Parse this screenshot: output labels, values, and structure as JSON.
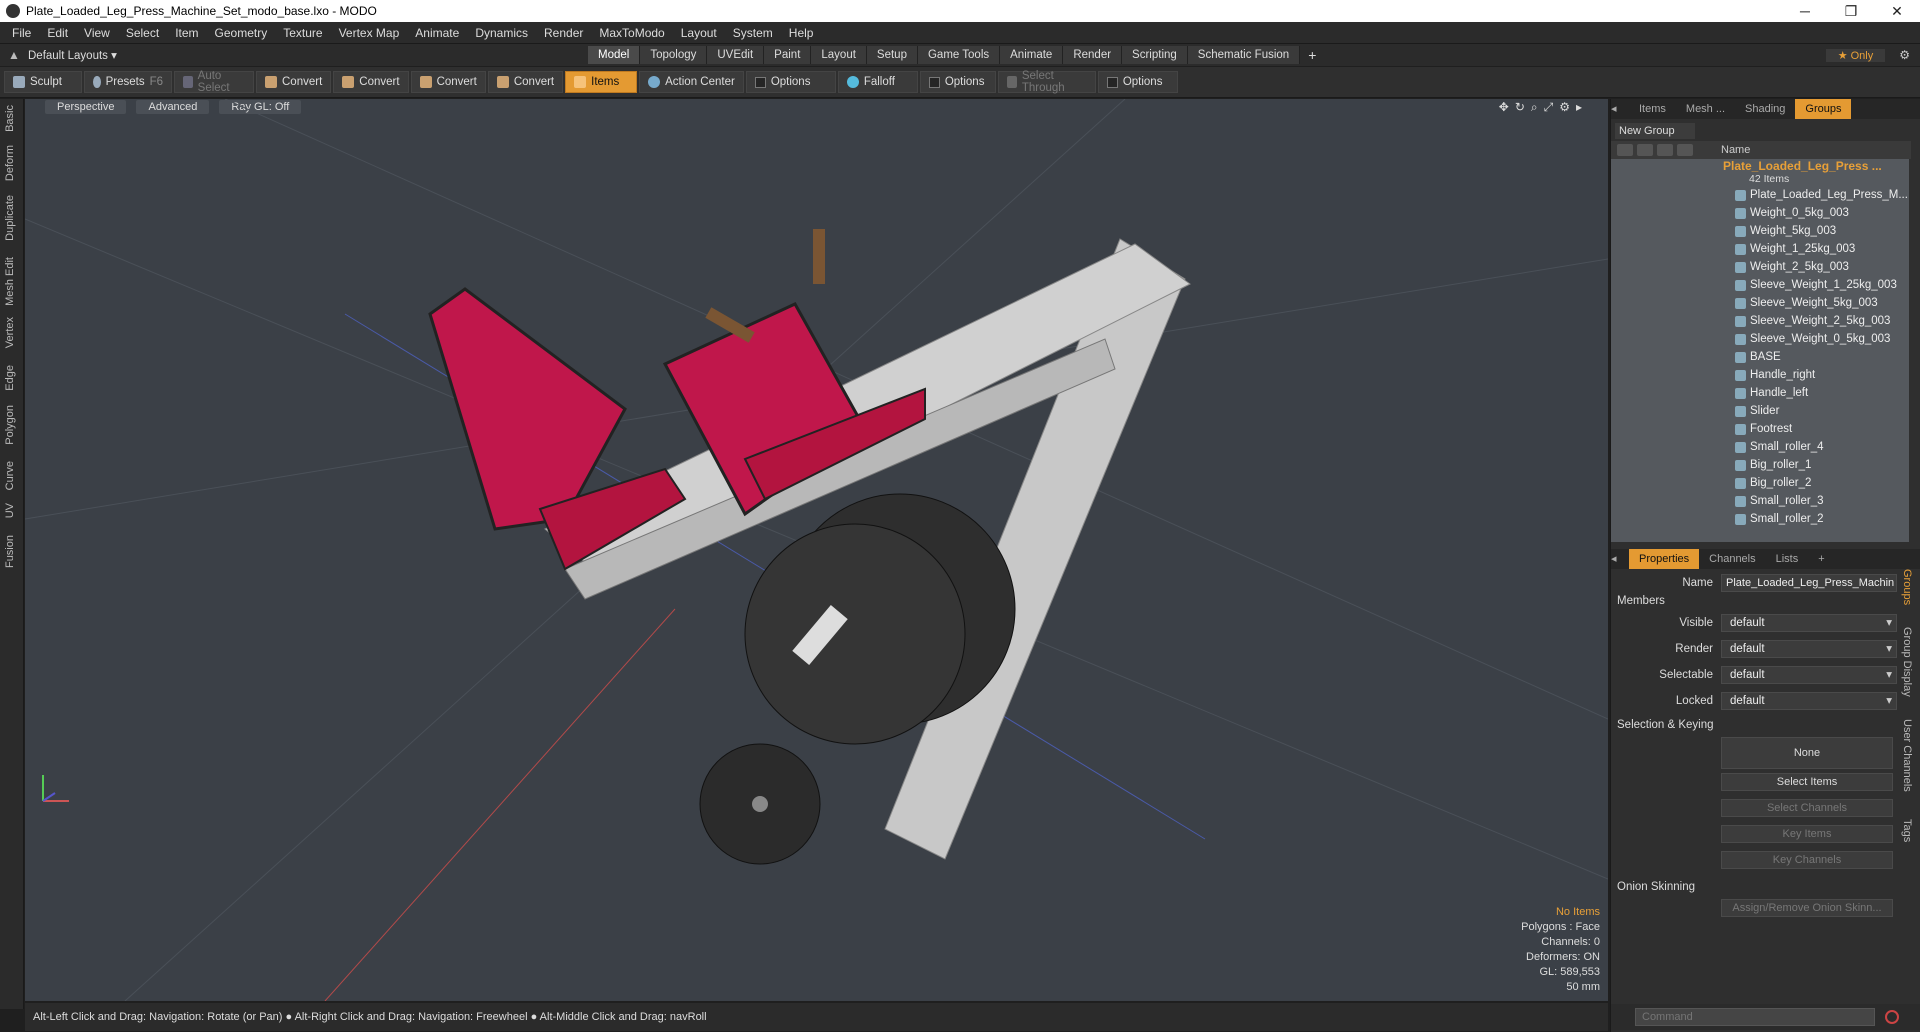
{
  "window": {
    "title": "Plate_Loaded_Leg_Press_Machine_Set_modo_base.lxo - MODO"
  },
  "menu": [
    "File",
    "Edit",
    "View",
    "Select",
    "Item",
    "Geometry",
    "Texture",
    "Vertex Map",
    "Animate",
    "Dynamics",
    "Render",
    "MaxToModo",
    "Layout",
    "System",
    "Help"
  ],
  "layout": {
    "default_label": "Default Layouts ▾",
    "tabs": [
      "Model",
      "Topology",
      "UVEdit",
      "Paint",
      "Layout",
      "Setup",
      "Game Tools",
      "Animate",
      "Render",
      "Scripting",
      "Schematic Fusion"
    ],
    "add": "+",
    "only": "★ Only"
  },
  "toolbar": {
    "sculpt": "Sculpt",
    "presets": "Presets",
    "presets_key": "F6",
    "auto_select": "Auto Select",
    "convert": "Convert",
    "items": "Items",
    "action_center": "Action Center",
    "options": "Options",
    "falloff": "Falloff",
    "select_through": "Select Through"
  },
  "left_tabs": [
    "Basic",
    "Deform",
    "Duplicate",
    "Mesh Edit",
    "Vertex",
    "Edge",
    "Polygon",
    "Curve",
    "UV",
    "Fusion"
  ],
  "viewport": {
    "perspective": "Perspective",
    "advanced": "Advanced",
    "raygl": "Ray GL: Off",
    "stats": {
      "no_items": "No Items",
      "polygons": "Polygons : Face",
      "channels": "Channels: 0",
      "deformers": "Deformers: ON",
      "gl": "GL: 589,553",
      "scale": "50 mm"
    }
  },
  "status": "Alt-Left Click and Drag: Navigation: Rotate (or Pan) ● Alt-Right Click and Drag: Navigation: Freewheel ● Alt-Middle Click and Drag: navRoll",
  "panel_tabs": [
    "Items",
    "Mesh ...",
    "Shading",
    "Groups"
  ],
  "new_group": "New Group",
  "list_header": "Name",
  "group": {
    "name": "Plate_Loaded_Leg_Press ...",
    "count": "42 Items"
  },
  "items": [
    "Plate_Loaded_Leg_Press_M...",
    "Weight_0_5kg_003",
    "Weight_5kg_003",
    "Weight_1_25kg_003",
    "Weight_2_5kg_003",
    "Sleeve_Weight_1_25kg_003",
    "Sleeve_Weight_5kg_003",
    "Sleeve_Weight_2_5kg_003",
    "Sleeve_Weight_0_5kg_003",
    "BASE",
    "Handle_right",
    "Handle_left",
    "Slider",
    "Footrest",
    "Small_roller_4",
    "Big_roller_1",
    "Big_roller_2",
    "Small_roller_3",
    "Small_roller_2"
  ],
  "prop_tabs": [
    "Properties",
    "Channels",
    "Lists",
    "+"
  ],
  "props": {
    "name_label": "Name",
    "name_value": "Plate_Loaded_Leg_Press_Machin",
    "members": "Members",
    "visible_label": "Visible",
    "render_label": "Render",
    "selectable_label": "Selectable",
    "locked_label": "Locked",
    "default": "default",
    "sel_keying": "Selection & Keying",
    "none": "None",
    "select_items": "Select Items",
    "select_channels": "Select Channels",
    "key_items": "Key Items",
    "key_channels": "Key Channels",
    "onion": "Onion Skinning",
    "assign_onion": "Assign/Remove Onion Skinn..."
  },
  "side_vtabs": [
    "Groups",
    "Group Display",
    "User Channels",
    "Tags"
  ],
  "command_placeholder": "Command"
}
